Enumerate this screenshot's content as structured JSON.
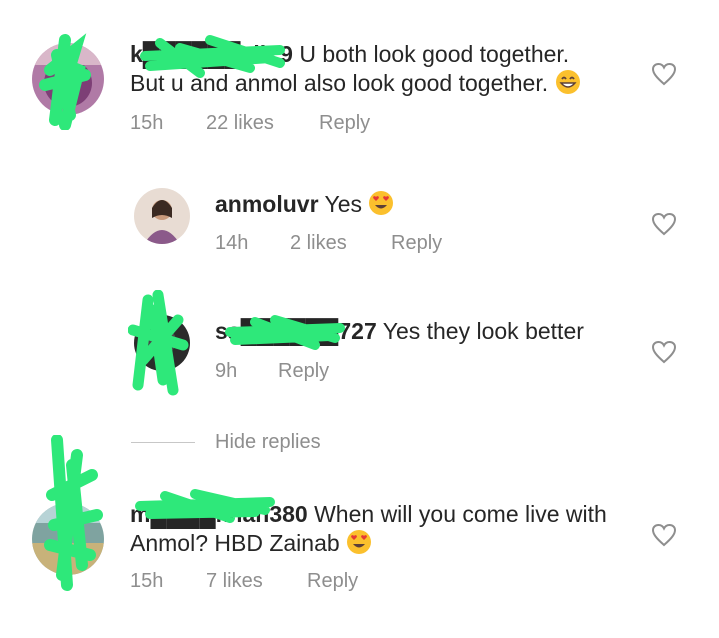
{
  "comments": [
    {
      "username": "k██████sih.9",
      "text_1": "U both look good together.",
      "text_2": "But u and anmol also look good together.",
      "emoji": "grinning-smiling-eyes-emoji",
      "time": "15h",
      "likes": "22 likes",
      "reply": "Reply"
    },
    {
      "username": "anmoluvr",
      "text": "Yes",
      "emoji": "heart-eyes-emoji",
      "time": "14h",
      "likes": "2 likes",
      "reply": "Reply"
    },
    {
      "username": "sa██████727",
      "text": "Yes they look better",
      "time": "9h",
      "reply": "Reply"
    },
    {
      "username": "m████khan380",
      "text_1": "When will you come live with",
      "text_2": "Anmol? HBD Zainab",
      "emoji": "heart-eyes-emoji",
      "time": "15h",
      "likes": "7 likes",
      "reply": "Reply"
    }
  ],
  "hide_replies": "Hide replies",
  "colors": {
    "primary_text": "#262626",
    "secondary_text": "#8e8e8e",
    "redaction": "#2ee87a",
    "divider": "#c7c7c7",
    "heart_stroke": "#8e8e8e"
  },
  "icons": {
    "like": "heart-outline-icon"
  }
}
